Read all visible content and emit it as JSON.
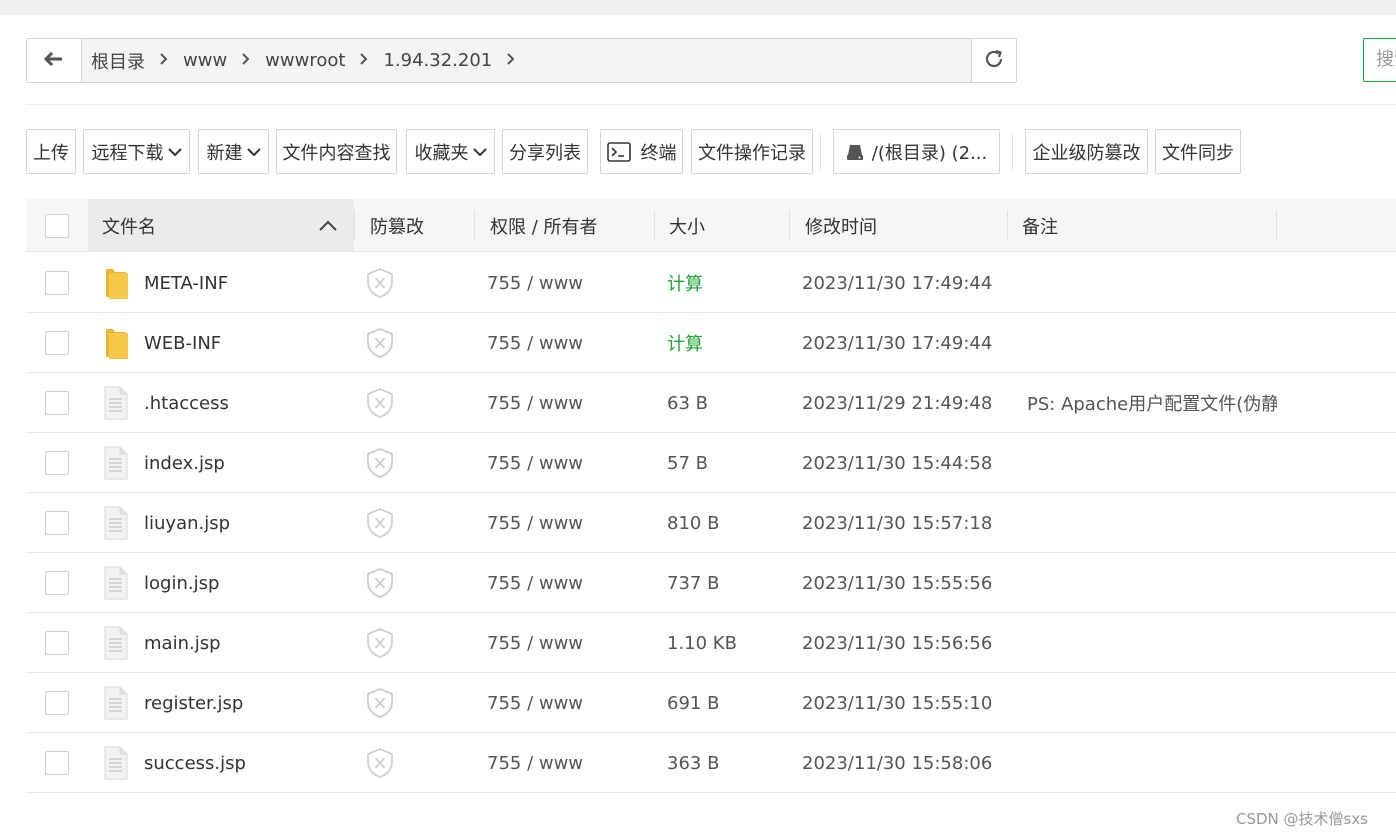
{
  "breadcrumb": {
    "items": [
      "根目录",
      "www",
      "wwwroot",
      "1.94.32.201"
    ]
  },
  "search": {
    "placeholder": "搜索"
  },
  "toolbar": {
    "upload": "上传",
    "remote_download": "远程下载",
    "new": "新建",
    "content_search": "文件内容查找",
    "favorites": "收藏夹",
    "share_list": "分享列表",
    "terminal": "终端",
    "op_log": "文件操作记录",
    "disk": "/(根目录) (2...",
    "tamper_proof": "企业级防篡改",
    "file_sync": "文件同步"
  },
  "table": {
    "headers": {
      "name": "文件名",
      "tamper": "防篡改",
      "perm": "权限 / 所有者",
      "size": "大小",
      "mtime": "修改时间",
      "note": "备注"
    },
    "rows": [
      {
        "type": "folder",
        "name": "META-INF",
        "perm": "755 / www",
        "size": "计算",
        "mtime": "2023/11/30 17:49:44",
        "note": ""
      },
      {
        "type": "folder",
        "name": "WEB-INF",
        "perm": "755 / www",
        "size": "计算",
        "mtime": "2023/11/30 17:49:44",
        "note": ""
      },
      {
        "type": "file",
        "name": ".htaccess",
        "perm": "755 / www",
        "size": "63 B",
        "mtime": "2023/11/29 21:49:48",
        "note": "PS: Apache用户配置文件(伪静态"
      },
      {
        "type": "file",
        "name": "index.jsp",
        "perm": "755 / www",
        "size": "57 B",
        "mtime": "2023/11/30 15:44:58",
        "note": ""
      },
      {
        "type": "file",
        "name": "liuyan.jsp",
        "perm": "755 / www",
        "size": "810 B",
        "mtime": "2023/11/30 15:57:18",
        "note": ""
      },
      {
        "type": "file",
        "name": "login.jsp",
        "perm": "755 / www",
        "size": "737 B",
        "mtime": "2023/11/30 15:55:56",
        "note": ""
      },
      {
        "type": "file",
        "name": "main.jsp",
        "perm": "755 / www",
        "size": "1.10 KB",
        "mtime": "2023/11/30 15:56:56",
        "note": ""
      },
      {
        "type": "file",
        "name": "register.jsp",
        "perm": "755 / www",
        "size": "691 B",
        "mtime": "2023/11/30 15:55:10",
        "note": ""
      },
      {
        "type": "file",
        "name": "success.jsp",
        "perm": "755 / www",
        "size": "363 B",
        "mtime": "2023/11/30 15:58:06",
        "note": ""
      }
    ]
  },
  "watermark": "CSDN @技术僧sxs",
  "colors": {
    "accent": "#20a53a",
    "folder": "#f7c948"
  }
}
